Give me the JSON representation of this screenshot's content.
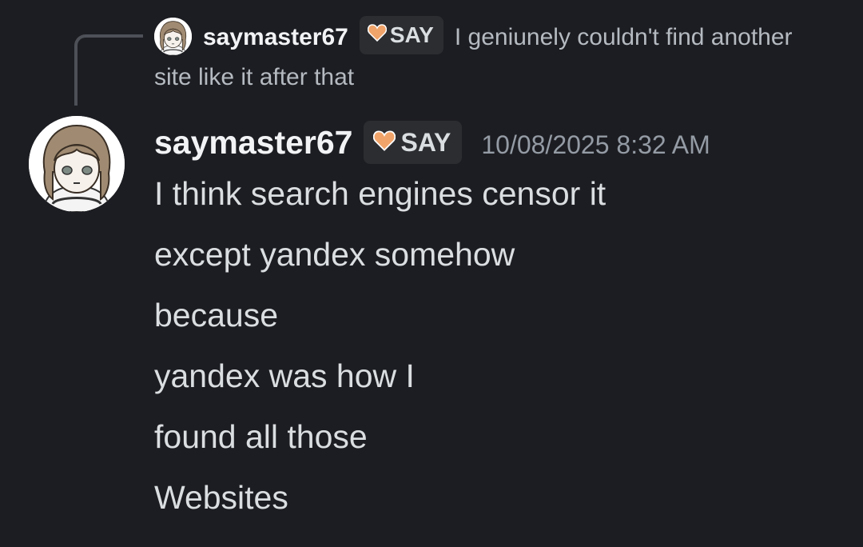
{
  "reply": {
    "author": "saymaster67",
    "tag": "SAY",
    "text": "I geniunely couldn't find another site like it after that"
  },
  "message": {
    "author": "saymaster67",
    "tag": "SAY",
    "timestamp": "10/08/2025 8:32 AM",
    "lines": [
      "I think search engines censor it",
      "except yandex somehow",
      "because",
      "yandex was how I",
      "found all those",
      "Websites"
    ]
  },
  "icons": {
    "avatar": "avatar-image",
    "tag_badge": "heart-icon"
  },
  "colors": {
    "background": "#1c1d22",
    "tag_background": "#2b2d31",
    "heart": "#f0a46a",
    "timestamp": "#949ba4"
  }
}
